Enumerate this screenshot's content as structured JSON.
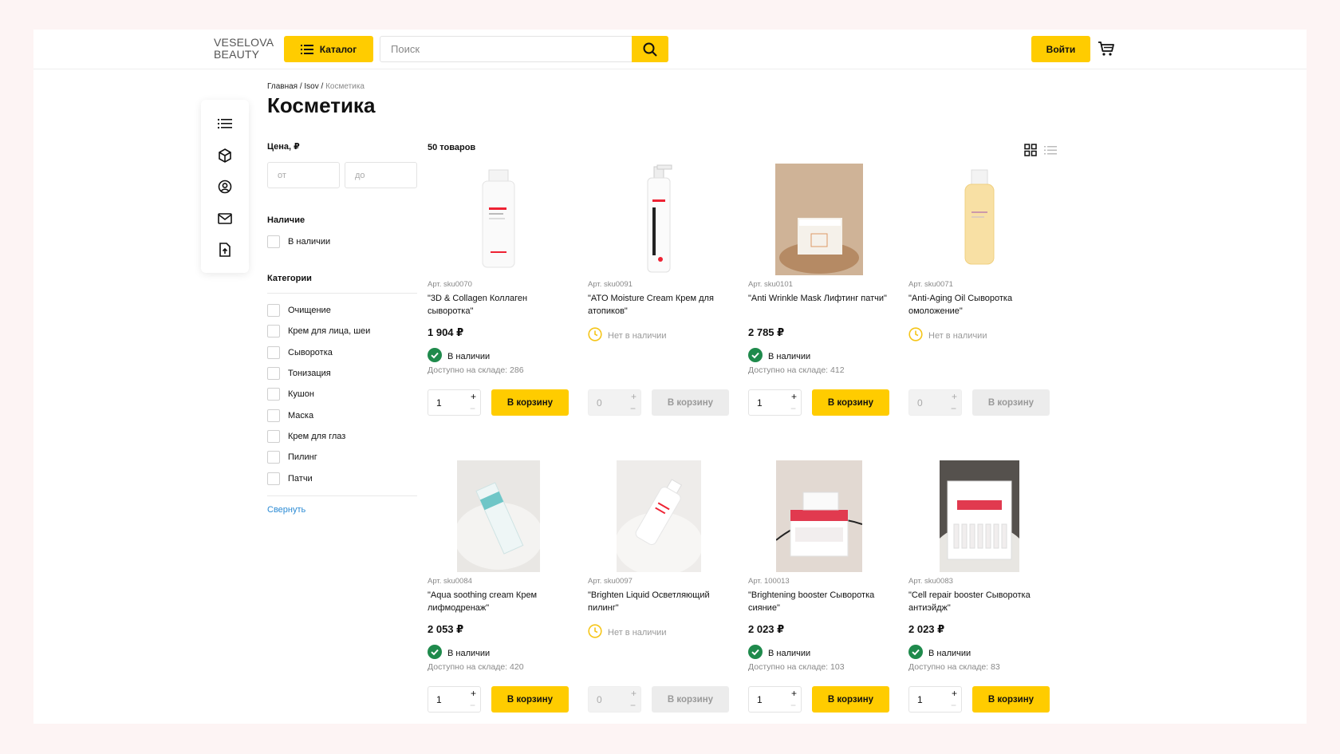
{
  "header": {
    "logo_line1": "VESELOVA",
    "logo_line2": "BEAUTY",
    "catalog_label": "Каталог",
    "search_placeholder": "Поиск",
    "login_label": "Войти"
  },
  "breadcrumb": {
    "home": "Главная",
    "brand": "Isov",
    "current": "Косметика",
    "sep": " / "
  },
  "page_title": "Косметика",
  "filters": {
    "price_label": "Цена, ₽",
    "price_from_placeholder": "от",
    "price_to_placeholder": "до",
    "availability_label": "Наличие",
    "in_stock_label": "В наличии",
    "categories_label": "Категории",
    "categories": [
      "Очищение",
      "Крем для лица, шеи",
      "Сыворотка",
      "Тонизация",
      "Кушон",
      "Маска",
      "Крем для глаз",
      "Пилинг",
      "Патчи"
    ],
    "collapse_label": "Свернуть"
  },
  "products_count": "50 товаров",
  "products": [
    {
      "sku": "Арт. sku0070",
      "name": "\"3D & Collagen Коллаген сыворотка\"",
      "price": "1 904 ₽",
      "stock": "В наличии",
      "available": "Доступно на складе: 286",
      "qty": "1",
      "buy": "В корзину",
      "in_stock": true,
      "image": "serum-pump-bottle"
    },
    {
      "sku": "Арт. sku0091",
      "name": "\"ATO Moisture Cream Крем для атопиков\"",
      "price": "",
      "stock": "Нет в наличии",
      "available": "",
      "qty": "0",
      "buy": "В корзину",
      "in_stock": false,
      "image": "tall-pump-bottle"
    },
    {
      "sku": "Арт. sku0101",
      "name": "\"Anti Wrinkle Mask Лифтинг патчи\"",
      "price": "2 785 ₽",
      "stock": "В наличии",
      "available": "Доступно на складе: 412",
      "qty": "1",
      "buy": "В корзину",
      "in_stock": true,
      "image": "patches-box-photo"
    },
    {
      "sku": "Арт. sku0071",
      "name": "\"Anti-Aging Oil Сыворотка омоложение\"",
      "price": "",
      "stock": "Нет в наличии",
      "available": "",
      "qty": "0",
      "buy": "В корзину",
      "in_stock": false,
      "image": "oil-bottle"
    },
    {
      "sku": "Арт. sku0084",
      "name": "\"Aqua soothing cream Крем лифмодренаж\"",
      "price": "2 053 ₽",
      "stock": "В наличии",
      "available": "Доступно на складе: 420",
      "qty": "1",
      "buy": "В корзину",
      "in_stock": true,
      "image": "cream-box-photo"
    },
    {
      "sku": "Арт. sku0097",
      "name": "\"Brighten Liquid Осветляющий пилинг\"",
      "price": "",
      "stock": "Нет в наличии",
      "available": "",
      "qty": "0",
      "buy": "В корзину",
      "in_stock": false,
      "image": "liquid-bottle-photo"
    },
    {
      "sku": "Арт. 100013",
      "name": "\"Brightening booster Сыворотка сияние\"",
      "price": "2 023 ₽",
      "stock": "В наличии",
      "available": "Доступно на складе: 103",
      "qty": "1",
      "buy": "В корзину",
      "in_stock": true,
      "image": "ampoule-box-photo"
    },
    {
      "sku": "Арт. sku0083",
      "name": "\"Cell repair booster Сыворотка антиэйдж\"",
      "price": "2 023 ₽",
      "stock": "В наличии",
      "available": "Доступно на складе: 83",
      "qty": "1",
      "buy": "В корзину",
      "in_stock": true,
      "image": "ampoule-set-photo"
    }
  ],
  "colors": {
    "accent": "#ffcc00",
    "in_stock": "#1f8a4c",
    "out_of_stock": "#f5c518",
    "link": "#2a8ad4"
  }
}
